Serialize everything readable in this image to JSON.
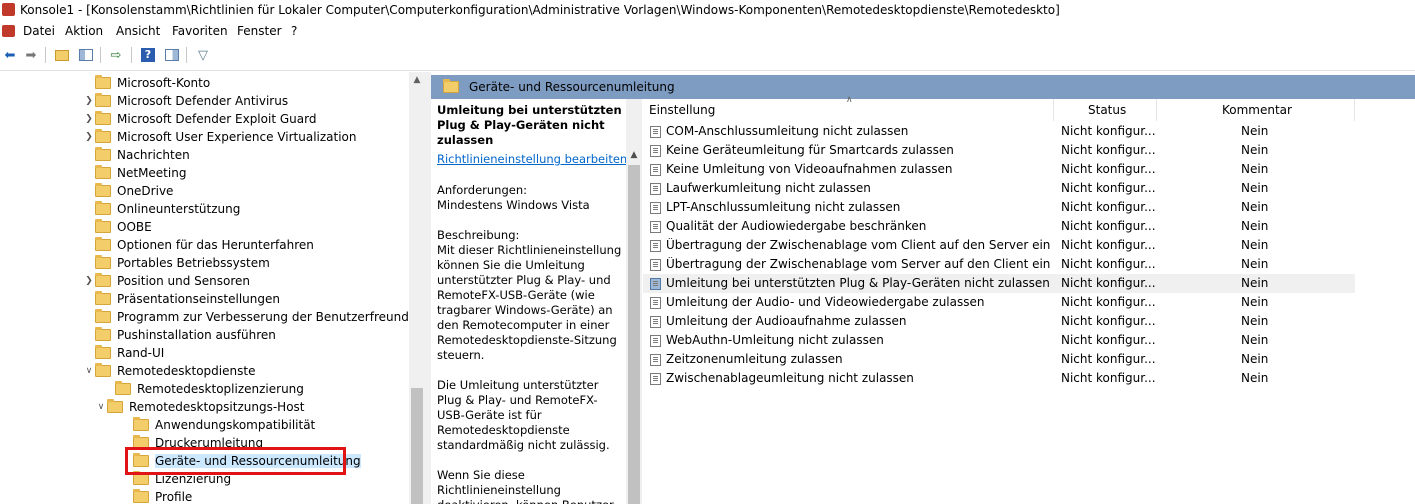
{
  "window": {
    "title": "Konsole1 - [Konsolenstamm\\Richtlinien für Lokaler Computer\\Computerkonfiguration\\Administrative Vorlagen\\Windows-Komponenten\\Remotedesktopdienste\\Remotedeskto]"
  },
  "menu": [
    "Datei",
    "Aktion",
    "Ansicht",
    "Favoriten",
    "Fenster",
    "?"
  ],
  "toolbar": {
    "icons": [
      "back-arrow-icon",
      "forward-arrow-icon",
      "up-folder-icon",
      "show-hide-tree-icon",
      "export-list-icon",
      "help-icon",
      "properties-icon",
      "filter-icon"
    ]
  },
  "tree": [
    {
      "label": "Microsoft-Konto",
      "expandable": false
    },
    {
      "label": "Microsoft Defender Antivirus",
      "expandable": true
    },
    {
      "label": "Microsoft Defender Exploit Guard",
      "expandable": true
    },
    {
      "label": "Microsoft User Experience Virtualization",
      "expandable": true
    },
    {
      "label": "Nachrichten",
      "expandable": false
    },
    {
      "label": "NetMeeting",
      "expandable": false
    },
    {
      "label": "OneDrive",
      "expandable": false
    },
    {
      "label": "Onlineunterstützung",
      "expandable": false
    },
    {
      "label": "OOBE",
      "expandable": false
    },
    {
      "label": "Optionen für das Herunterfahren",
      "expandable": false
    },
    {
      "label": "Portables Betriebssystem",
      "expandable": false
    },
    {
      "label": "Position und Sensoren",
      "expandable": true
    },
    {
      "label": "Präsentationseinstellungen",
      "expandable": false
    },
    {
      "label": "Programm zur Verbesserung der Benutzerfreundlichkeit",
      "expandable": false
    },
    {
      "label": "Pushinstallation ausführen",
      "expandable": false
    },
    {
      "label": "Rand-UI",
      "expandable": false
    },
    {
      "label": "Remotedesktopdienste",
      "expandable": true,
      "expanded": true
    },
    {
      "label": "Remotedesktoplizenzierung",
      "expandable": false
    },
    {
      "label": "Remotedesktopsitzungs-Host",
      "expandable": true,
      "expanded": true
    },
    {
      "label": "Anwendungskompatibilität",
      "expandable": false
    },
    {
      "label": "Druckerumleitung",
      "expandable": false
    },
    {
      "label": "Geräte- und Ressourcenumleitung",
      "expandable": false,
      "selected": true
    },
    {
      "label": "Lizenzierung",
      "expandable": false
    },
    {
      "label": "Profile",
      "expandable": false
    }
  ],
  "details": {
    "header": "Geräte- und Ressourcenumleitung",
    "description": {
      "title": "Umleitung bei unterstützten Plug & Play-Geräten nicht zulassen",
      "link": "Richtlinieneinstellung bearbeiten",
      "requirements_label": "Anforderungen:",
      "requirements": "Mindestens Windows Vista",
      "description_label": "Beschreibung:",
      "paragraph1": "Mit dieser Richtlinieneinstellung können Sie die Umleitung unterstützter Plug & Play- und RemoteFX-USB-Geräte (wie tragbarer Windows-Geräte) an den Remotecomputer in einer Remotedesktopdienste-Sitzung steuern.",
      "paragraph2": "Die Umleitung unterstützter Plug & Play- und RemoteFX-USB-Geräte ist für Remotedesktopdienste standardmäßig nicht zulässig.",
      "paragraph3": "Wenn Sie diese Richtlinieneinstellung deaktivieren, können Benutzer ihre"
    },
    "columns": {
      "setting": "Einstellung",
      "status": "Status",
      "comment": "Kommentar"
    },
    "rows": [
      {
        "name": "COM-Anschlussumleitung nicht zulassen",
        "status": "Nicht konfigur...",
        "comment": "Nein"
      },
      {
        "name": "Keine Geräteumleitung für Smartcards zulassen",
        "status": "Nicht konfigur...",
        "comment": "Nein"
      },
      {
        "name": "Keine Umleitung von Videoaufnahmen zulassen",
        "status": "Nicht konfigur...",
        "comment": "Nein"
      },
      {
        "name": "Laufwerkumleitung nicht zulassen",
        "status": "Nicht konfigur...",
        "comment": "Nein"
      },
      {
        "name": "LPT-Anschlussumleitung nicht zulassen",
        "status": "Nicht konfigur...",
        "comment": "Nein"
      },
      {
        "name": "Qualität der Audiowiedergabe beschränken",
        "status": "Nicht konfigur...",
        "comment": "Nein"
      },
      {
        "name": "Übertragung der Zwischenablage vom Client auf den Server einschränk...",
        "status": "Nicht konfigur...",
        "comment": "Nein"
      },
      {
        "name": "Übertragung der Zwischenablage vom Server auf den Client einschränk...",
        "status": "Nicht konfigur...",
        "comment": "Nein"
      },
      {
        "name": "Umleitung bei unterstützten Plug & Play-Geräten nicht zulassen",
        "status": "Nicht konfigur...",
        "comment": "Nein",
        "selected": true
      },
      {
        "name": "Umleitung der Audio- und Videowiedergabe zulassen",
        "status": "Nicht konfigur...",
        "comment": "Nein"
      },
      {
        "name": "Umleitung der Audioaufnahme zulassen",
        "status": "Nicht konfigur...",
        "comment": "Nein"
      },
      {
        "name": "WebAuthn-Umleitung nicht zulassen",
        "status": "Nicht konfigur...",
        "comment": "Nein"
      },
      {
        "name": "Zeitzonenumleitung zulassen",
        "status": "Nicht konfigur...",
        "comment": "Nein"
      },
      {
        "name": "Zwischenablageumleitung nicht zulassen",
        "status": "Nicht konfigur...",
        "comment": "Nein"
      }
    ]
  }
}
